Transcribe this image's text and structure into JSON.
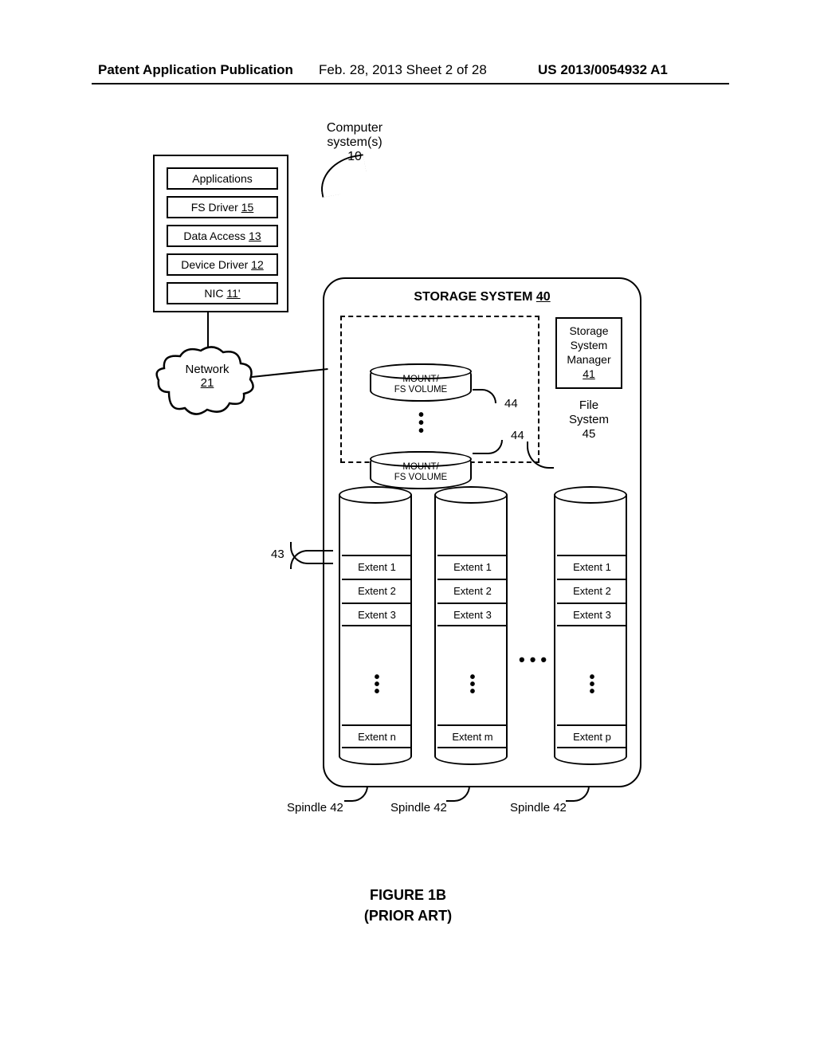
{
  "header": {
    "left": "Patent Application Publication",
    "center": "Feb. 28, 2013  Sheet 2 of 28",
    "right": "US 2013/0054932 A1"
  },
  "computer": {
    "label_line1": "Computer",
    "label_line2": "system(s)",
    "label_num": "10",
    "rows": {
      "apps": "Applications",
      "fsd_text": "FS Driver ",
      "fsd_num": "15",
      "da_text": "Data Access ",
      "da_num": "13",
      "dd_text": "Device Driver ",
      "dd_num": "12",
      "nic_text": "NIC ",
      "nic_num": "11'"
    }
  },
  "network": {
    "label": "Network",
    "num": "21"
  },
  "storage": {
    "title_text": "STORAGE SYSTEM ",
    "title_num": "40",
    "mgr_l1": "Storage",
    "mgr_l2": "System",
    "mgr_l3": "Manager",
    "mgr_num": "41",
    "fs_l1": "File",
    "fs_l2": "System",
    "fs_num": "45",
    "vol_l1": "MOUNT/",
    "vol_l2": "FS VOLUME",
    "vol_ref": "44",
    "ref43": "43",
    "extents_s1": [
      "Extent 1",
      "Extent 2",
      "Extent 3"
    ],
    "extents_s2": [
      "Extent 1",
      "Extent 2",
      "Extent 3"
    ],
    "extents_s3": [
      "Extent 1",
      "Extent 2",
      "Extent 3"
    ],
    "extent_last_s1": "Extent n",
    "extent_last_s2": "Extent m",
    "extent_last_s3": "Extent p",
    "spindle_label": "Spindle 42"
  },
  "figure": {
    "l1": "FIGURE 1B",
    "l2": "(PRIOR ART)"
  }
}
